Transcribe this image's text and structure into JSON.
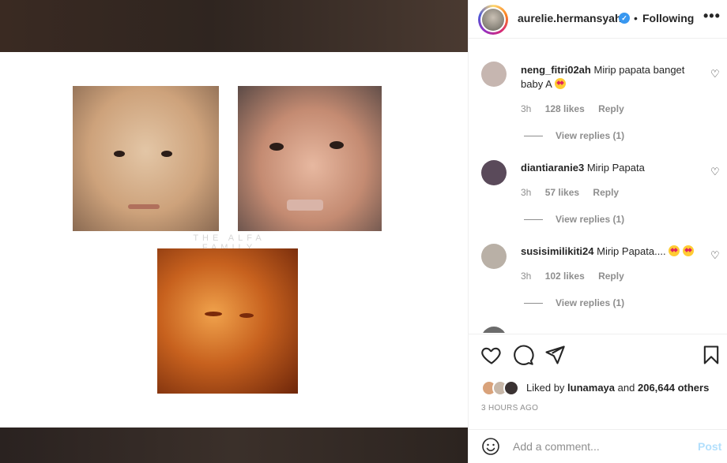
{
  "media": {
    "caption_text": "THE ALFA FAMILY"
  },
  "header": {
    "username": "aurelie.hermansyah",
    "verified_mark": "✓",
    "separator": "•",
    "follow_status": "Following",
    "more_icon": "•••"
  },
  "comments": [
    {
      "user": "neng_fitri02ah",
      "text": "Mirip papata banget baby A",
      "emoji": "heart-eyes",
      "time": "3h",
      "likes": "128 likes",
      "reply": "Reply",
      "view_replies": "View replies (1)",
      "avatar_color": "#c6b6b0"
    },
    {
      "user": "diantiaranie3",
      "text": "Mirip Papata",
      "emoji": "",
      "time": "3h",
      "likes": "57 likes",
      "reply": "Reply",
      "view_replies": "View replies (1)",
      "avatar_color": "#5a4a5a"
    },
    {
      "user": "susisimilikiti24",
      "text": "Mirip Papata....",
      "emoji": "heart-eyes x2",
      "time": "3h",
      "likes": "102 likes",
      "reply": "Reply",
      "view_replies": "View replies (1)",
      "avatar_color": "#b9b0a6"
    }
  ],
  "actions": {
    "like_icon": "heart-icon",
    "comment_icon": "comment-icon",
    "share_icon": "share-icon",
    "save_icon": "bookmark-icon"
  },
  "likes": {
    "prefix": "Liked by",
    "user": "lunamaya",
    "middle": "and",
    "others": "206,644 others"
  },
  "time_ago": "3 HOURS AGO",
  "add_comment": {
    "placeholder": "Add a comment...",
    "post_label": "Post"
  },
  "colors": {
    "text": "#262626",
    "muted": "#8e8e8e",
    "verified": "#3897f0",
    "post_disabled": "#b2dffc"
  }
}
